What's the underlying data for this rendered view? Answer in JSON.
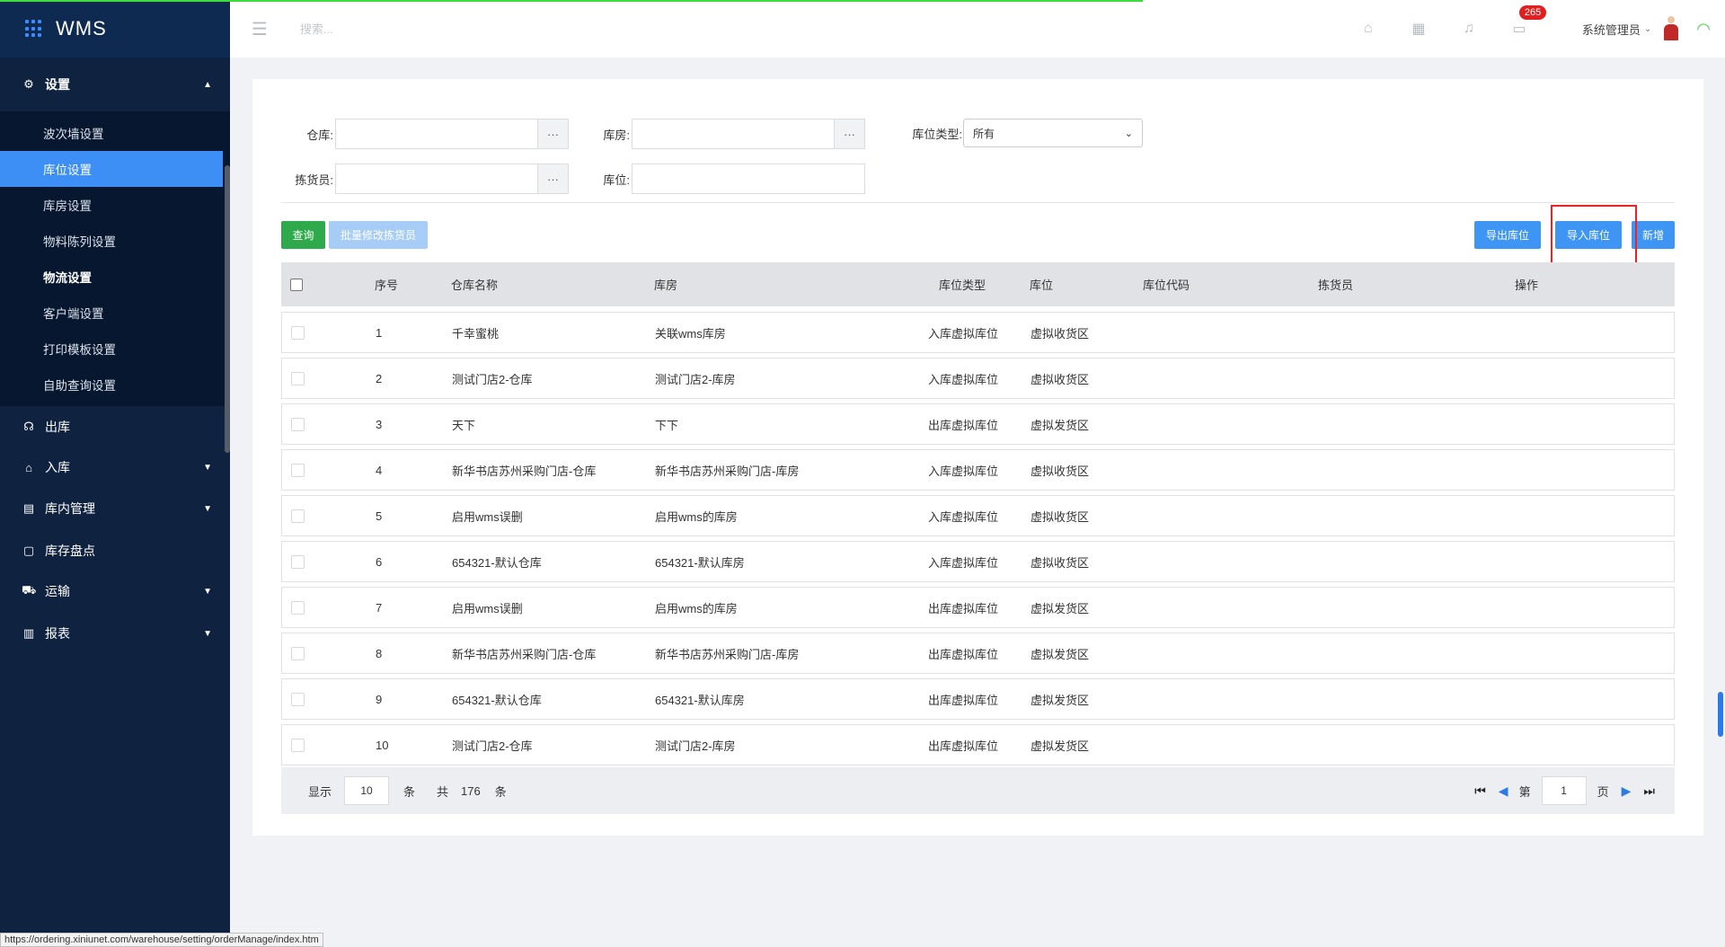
{
  "app": {
    "title": "WMS"
  },
  "header": {
    "search_placeholder": "搜索...",
    "badge_count": "265",
    "user_name": "系统管理员"
  },
  "sidebar": {
    "settings": {
      "label": "设置",
      "items": [
        {
          "label": "波次墙设置"
        },
        {
          "label": "库位设置"
        },
        {
          "label": "库房设置"
        },
        {
          "label": "物料陈列设置"
        },
        {
          "label": "物流设置"
        },
        {
          "label": "客户端设置"
        },
        {
          "label": "打印模板设置"
        },
        {
          "label": "自助查询设置"
        }
      ]
    },
    "groups": [
      {
        "label": "出库"
      },
      {
        "label": "入库"
      },
      {
        "label": "库内管理"
      },
      {
        "label": "库存盘点"
      },
      {
        "label": "运输"
      },
      {
        "label": "报表"
      }
    ]
  },
  "filters": {
    "warehouse_label": "仓库:",
    "room_label": "库房:",
    "loc_type_label": "库位类型:",
    "loc_type_value": "所有",
    "picker_label": "拣货员:",
    "location_label": "库位:"
  },
  "buttons": {
    "query": "查询",
    "batch_edit": "批量修改拣货员",
    "export": "导出库位",
    "import": "导入库位",
    "add": "新增"
  },
  "table": {
    "headers": {
      "no": "序号",
      "warehouse": "仓库名称",
      "room": "库房",
      "type": "库位类型",
      "location": "库位",
      "code": "库位代码",
      "picker": "拣货员",
      "op": "操作"
    },
    "rows": [
      {
        "no": "1",
        "warehouse": "千幸蜜桃",
        "room": "关联wms库房",
        "type": "入库虚拟库位",
        "location": "虚拟收货区"
      },
      {
        "no": "2",
        "warehouse": "测试门店2-仓库",
        "room": "测试门店2-库房",
        "type": "入库虚拟库位",
        "location": "虚拟收货区"
      },
      {
        "no": "3",
        "warehouse": "天下",
        "room": "下下",
        "type": "出库虚拟库位",
        "location": "虚拟发货区"
      },
      {
        "no": "4",
        "warehouse": "新华书店苏州采购门店-仓库",
        "room": "新华书店苏州采购门店-库房",
        "type": "入库虚拟库位",
        "location": "虚拟收货区"
      },
      {
        "no": "5",
        "warehouse": "启用wms误删",
        "room": "启用wms的库房",
        "type": "入库虚拟库位",
        "location": "虚拟收货区"
      },
      {
        "no": "6",
        "warehouse": "654321-默认仓库",
        "room": "654321-默认库房",
        "type": "入库虚拟库位",
        "location": "虚拟收货区"
      },
      {
        "no": "7",
        "warehouse": "启用wms误删",
        "room": "启用wms的库房",
        "type": "出库虚拟库位",
        "location": "虚拟发货区"
      },
      {
        "no": "8",
        "warehouse": "新华书店苏州采购门店-仓库",
        "room": "新华书店苏州采购门店-库房",
        "type": "出库虚拟库位",
        "location": "虚拟发货区"
      },
      {
        "no": "9",
        "warehouse": "654321-默认仓库",
        "room": "654321-默认库房",
        "type": "出库虚拟库位",
        "location": "虚拟发货区"
      },
      {
        "no": "10",
        "warehouse": "测试门店2-仓库",
        "room": "测试门店2-库房",
        "type": "出库虚拟库位",
        "location": "虚拟发货区"
      }
    ]
  },
  "pager": {
    "show_label": "显示",
    "page_size": "10",
    "unit": "条",
    "total_label": "共",
    "total": "176",
    "page_label": "第",
    "page": "1",
    "page_suffix": "页"
  },
  "status_url": "https://ordering.xiniunet.com/warehouse/setting/orderManage/index.htm"
}
